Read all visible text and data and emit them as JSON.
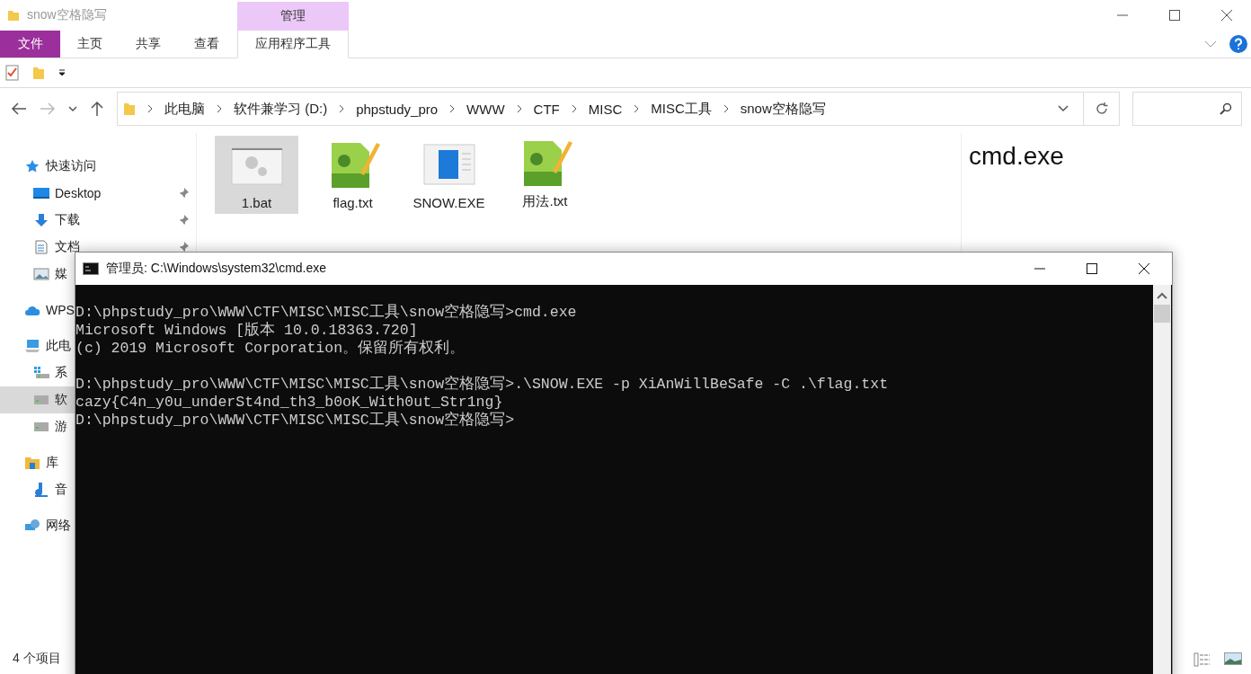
{
  "explorer": {
    "title": "snow空格隐写",
    "context_tab": "管理",
    "ribbon_tabs": [
      {
        "label": "文件",
        "kind": "file",
        "selected": false
      },
      {
        "label": "主页",
        "kind": "tab",
        "selected": false
      },
      {
        "label": "共享",
        "kind": "tab",
        "selected": false
      },
      {
        "label": "查看",
        "kind": "tab",
        "selected": false
      },
      {
        "label": "应用程序工具",
        "kind": "context",
        "selected": true
      }
    ],
    "breadcrumb": [
      "此电脑",
      "软件兼学习 (D:)",
      "phpstudy_pro",
      "WWW",
      "CTF",
      "MISC",
      "MISC工具",
      "snow空格隐写"
    ],
    "sidebar": [
      {
        "label": "快速访问",
        "kind": "star",
        "selected": false,
        "children": [
          {
            "label": "Desktop",
            "kind": "desktop",
            "pinned": true,
            "selected": false
          },
          {
            "label": "下载",
            "kind": "download",
            "pinned": true,
            "selected": false
          },
          {
            "label": "文档",
            "kind": "document",
            "pinned": true,
            "selected": false
          },
          {
            "label": "媒",
            "kind": "image",
            "pinned": false,
            "selected": false
          }
        ]
      },
      {
        "label": "WPS",
        "kind": "cloud",
        "selected": false
      },
      {
        "label": "此电",
        "kind": "pc",
        "selected": false,
        "children": [
          {
            "label": "系",
            "kind": "windrive",
            "pinned": false,
            "selected": false
          },
          {
            "label": "软",
            "kind": "drive",
            "pinned": false,
            "selected": true
          },
          {
            "label": "游",
            "kind": "drive",
            "pinned": false,
            "selected": false
          }
        ]
      },
      {
        "label": "库",
        "kind": "library",
        "selected": false,
        "children": [
          {
            "label": "音",
            "kind": "music",
            "pinned": false,
            "selected": false
          }
        ]
      },
      {
        "label": "网络",
        "kind": "network",
        "selected": false
      }
    ],
    "files": [
      {
        "name": "1.bat",
        "kind": "bat",
        "selected": true
      },
      {
        "name": "flag.txt",
        "kind": "notepad",
        "selected": false
      },
      {
        "name": "SNOW.EXE",
        "kind": "exe",
        "selected": false
      },
      {
        "name": "用法.txt",
        "kind": "notepad",
        "selected": false
      }
    ],
    "preview_title": "cmd.exe",
    "status_bar": "4 个项目"
  },
  "console": {
    "title": "管理员: C:\\Windows\\system32\\cmd.exe",
    "blocks": [
      [
        "D:\\phpstudy_pro\\WWW\\CTF\\MISC\\MISC工具\\snow空格隐写>cmd.exe",
        "Microsoft Windows [版本 10.0.18363.720]",
        "(c) 2019 Microsoft Corporation。保留所有权利。"
      ],
      [
        "D:\\phpstudy_pro\\WWW\\CTF\\MISC\\MISC工具\\snow空格隐写>.\\SNOW.EXE -p XiAnWillBeSafe -C .\\flag.txt",
        "cazy{C4n_y0u_underSt4nd_th3_b0oK_With0ut_Str1ng}",
        "D:\\phpstudy_pro\\WWW\\CTF\\MISC\\MISC工具\\snow空格隐写>"
      ]
    ]
  }
}
